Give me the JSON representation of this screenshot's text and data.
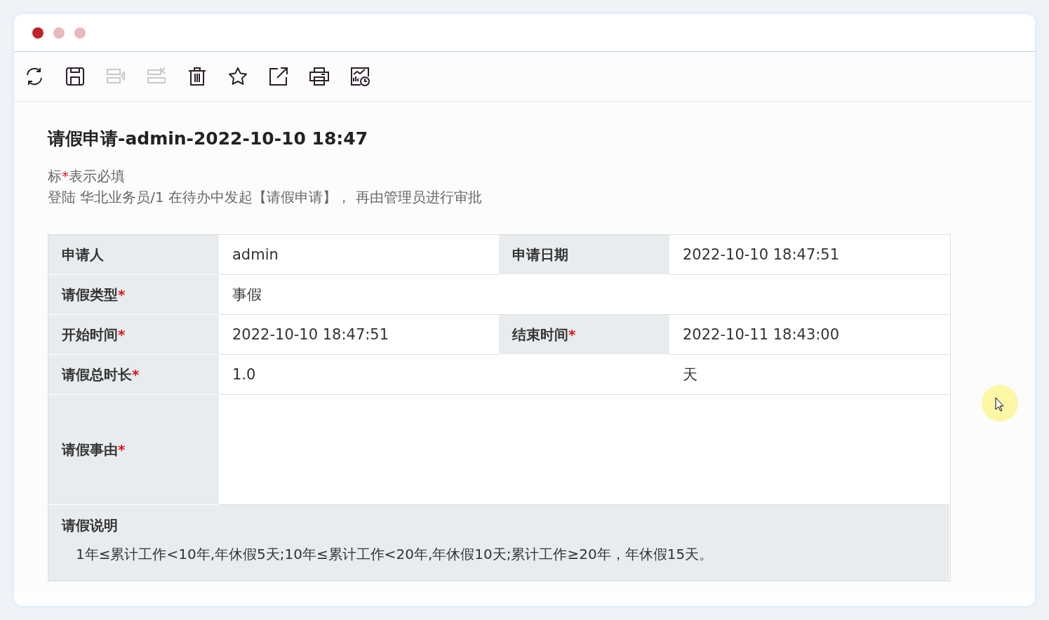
{
  "window": {
    "controls": [
      {
        "color": "#c0232a"
      },
      {
        "color": "#e8b9bd"
      },
      {
        "color": "#e8b9bd"
      }
    ]
  },
  "toolbar": [
    {
      "kind": "refresh",
      "disabled": false
    },
    {
      "kind": "save",
      "disabled": false
    },
    {
      "kind": "submit",
      "disabled": true
    },
    {
      "kind": "cancel",
      "disabled": true
    },
    {
      "kind": "delete",
      "disabled": false
    },
    {
      "kind": "favorite",
      "disabled": false
    },
    {
      "kind": "export",
      "disabled": false
    },
    {
      "kind": "print",
      "disabled": false
    },
    {
      "kind": "report",
      "disabled": false
    }
  ],
  "title": "请假申请-admin-2022-10-10 18:47",
  "note": {
    "before": "标",
    "mark": "*",
    "after": "表示必填"
  },
  "instruction": "登陆 华北业务员/1 在待办中发起【请假申请】， 再由管理员进行审批",
  "form": {
    "rows": [
      {
        "kind": "pair",
        "fields": [
          {
            "label": "申请人",
            "value": "admin"
          },
          {
            "label": "申请日期",
            "value": "2022-10-10 18:47:51"
          }
        ]
      },
      {
        "kind": "wide",
        "fields": [
          {
            "label": "请假类型",
            "mark": "*",
            "value": "事假"
          }
        ]
      },
      {
        "kind": "pair",
        "fields": [
          {
            "label": "开始时间",
            "mark": "*",
            "value": "2022-10-10 18:47:51"
          },
          {
            "label": "结束时间",
            "mark": "*",
            "value": "2022-10-11 18:43:00"
          }
        ]
      },
      {
        "kind": "unit",
        "fields": [
          {
            "label": "请假总时长",
            "mark": "*",
            "value": "1.0",
            "unit": "天"
          }
        ]
      },
      {
        "kind": "textarea",
        "fields": [
          {
            "label": "请假事由",
            "mark": "*"
          }
        ]
      }
    ],
    "notes": {
      "label": "请假说明",
      "text": "1年≤累计工作<10年,年休假5天;10年≤累计工作<20年,年休假10天;累计工作≥20年，年休假15天。"
    }
  }
}
